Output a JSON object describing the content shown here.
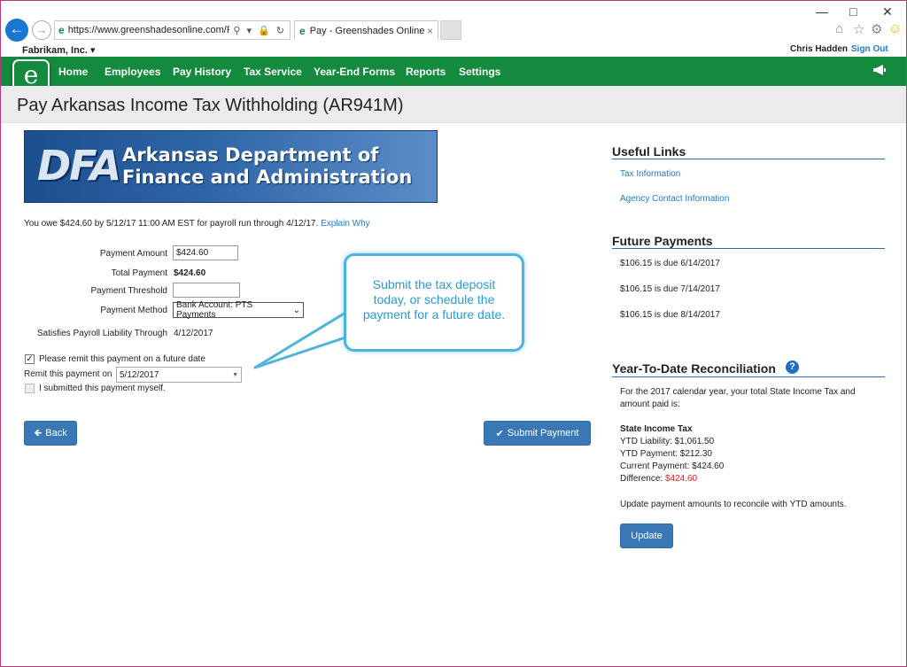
{
  "browser": {
    "url": "https://www.greenshadesonline.com/FileF",
    "tab_title": "Pay - Greenshades Online",
    "address_icons": "⚲ ▾ 🔒 ↻",
    "tab_close": "×"
  },
  "header": {
    "company": "Fabrikam, Inc.",
    "user": "Chris Hadden",
    "signout": "Sign Out"
  },
  "nav": {
    "items": [
      "Home",
      "Employees",
      "Pay History",
      "Tax Service",
      "Year-End Forms",
      "Reports",
      "Settings"
    ]
  },
  "page": {
    "title": "Pay Arkansas Income Tax Withholding (AR941M)"
  },
  "banner": {
    "logo_text": "DFA",
    "line1": "Arkansas Department of",
    "line2": "Finance and Administration"
  },
  "notice": {
    "text": "You owe $424.60 by 5/12/17 11:00 AM EST for payroll run through 4/12/17.",
    "link": "Explain Why"
  },
  "form": {
    "payment_amount_label": "Payment Amount",
    "payment_amount_value": "$424.60",
    "total_payment_label": "Total Payment",
    "total_payment_value": "$424.60",
    "threshold_label": "Payment Threshold",
    "threshold_value": "",
    "method_label": "Payment Method",
    "method_value": "Bank Account: PTS Payments",
    "satisfies_label": "Satisfies Payroll Liability Through",
    "satisfies_value": "4/12/2017",
    "future_checkbox_label": "Please remit this payment on a future date",
    "future_checked": true,
    "remit_label": "Remit this payment on",
    "remit_value": "5/12/2017",
    "self_submitted_label": "I submitted this payment myself.",
    "self_submitted_checked": false
  },
  "buttons": {
    "back": "Back",
    "submit": "Submit Payment",
    "update": "Update"
  },
  "callout": {
    "text": "Submit the tax deposit today, or schedule the payment for a future date."
  },
  "sidebar": {
    "useful_links_title": "Useful Links",
    "links": [
      "Tax Information",
      "Agency Contact Information"
    ],
    "future_title": "Future Payments",
    "future_payments": [
      "$106.15 is due 6/14/2017",
      "$106.15 is due 7/14/2017",
      "$106.15 is due 8/14/2017"
    ],
    "ytd_title": "Year-To-Date Reconciliation",
    "ytd_intro": "For the 2017 calendar year, your total State Income Tax and amount paid is:",
    "ytd_section": "State Income Tax",
    "ytd_liability": "YTD Liability: $1,061.50",
    "ytd_payment": "YTD Payment: $212.30",
    "current_payment": "Current Payment: $424.60",
    "difference_label": "Difference: ",
    "difference_value": "$424.60",
    "update_note": "Update payment amounts to reconcile with YTD amounts."
  },
  "colors": {
    "nav_green": "#138a3d",
    "link_blue": "#1e7bd0",
    "button_blue": "#3a78b5",
    "difference_red": "#e0201c",
    "callout_blue": "#4eb3dd"
  }
}
